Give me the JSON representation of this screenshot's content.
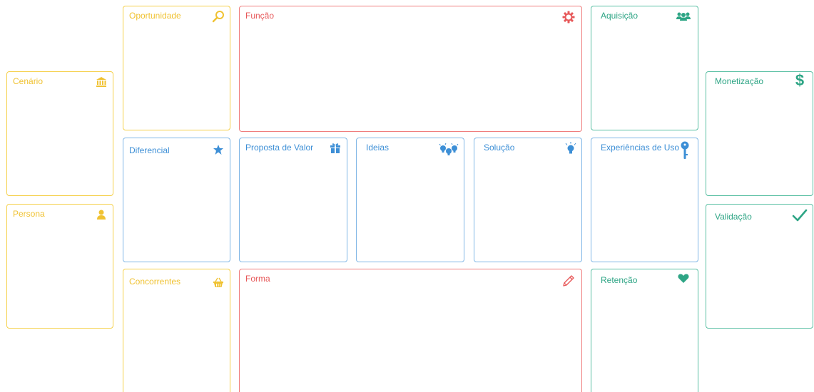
{
  "canvas": {
    "cards": {
      "cenario": {
        "title": "Cenário",
        "icon": "bank-icon"
      },
      "persona": {
        "title": "Persona",
        "icon": "user-icon"
      },
      "oportunidade": {
        "title": "Oportunidade",
        "icon": "search-icon"
      },
      "diferencial": {
        "title": "Diferencial",
        "icon": "star-icon"
      },
      "concorrentes": {
        "title": "Concorrentes",
        "icon": "basket-icon"
      },
      "funcao": {
        "title": "Função",
        "icon": "gear-icon"
      },
      "proposta": {
        "title": "Proposta de Valor",
        "icon": "gift-icon"
      },
      "ideias": {
        "title": "Ideias",
        "icon": "lightbulbs-icon"
      },
      "solucao": {
        "title": "Solução",
        "icon": "lightbulb-icon"
      },
      "forma": {
        "title": "Forma",
        "icon": "pencil-icon"
      },
      "aquisicao": {
        "title": "Aquisição",
        "icon": "users-icon"
      },
      "experiencias": {
        "title": "Experiências de Uso",
        "icon": "key-icon"
      },
      "retencao": {
        "title": "Retenção",
        "icon": "heart-icon"
      },
      "monetizacao": {
        "title": "Monetização",
        "icon": "dollar-icon"
      },
      "validacao": {
        "title": "Validação",
        "icon": "checkmark-icon"
      }
    }
  },
  "colors": {
    "yellow": "#f5d04a",
    "red": "#ef7d7d",
    "blue": "#7fb6e6",
    "teal": "#59bfa3"
  }
}
